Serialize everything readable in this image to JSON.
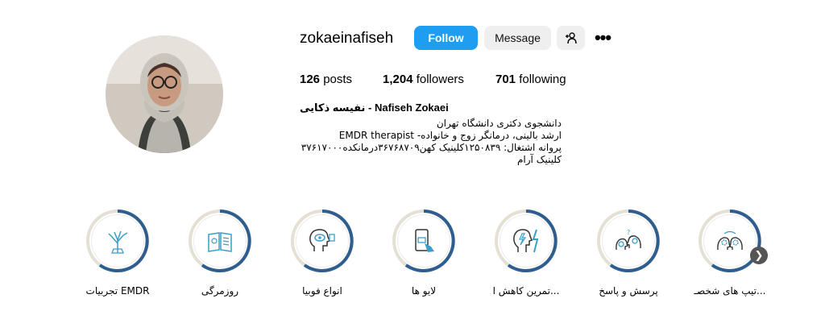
{
  "profile": {
    "username": "zokaeinafiseh",
    "follow_label": "Follow",
    "message_label": "Message",
    "add_user_icon": "add-user-icon",
    "more_icon": "more-options-icon",
    "more_glyph": "•••",
    "full_name": "نفیسه ذکایی - Nafiseh Zokaei",
    "bio_lines": [
      "دانشجوی دکتری دانشگاه تهران",
      "ارشد بالینی، درمانگر زوج و خانواده- EMDR therapist",
      "پروانه اشتغال: ۱۲۵۰۸۳۹کلینیک کهن۳۶۷۶۸۷۰۹درمانکده۳۷۶۱۷۰۰۰",
      "کلینیک آرام"
    ]
  },
  "stats": {
    "posts_count": "126",
    "posts_label": "posts",
    "followers_count": "1,204",
    "followers_label": "followers",
    "following_count": "701",
    "following_label": "following"
  },
  "highlights": [
    {
      "label": "تجربیات EMDR",
      "icon": "tree-icon"
    },
    {
      "label": "روزمرگی",
      "icon": "book-icon"
    },
    {
      "label": "انواع فوبیا",
      "icon": "head-eye-icon"
    },
    {
      "label": "لایو ها",
      "icon": "phone-tap-icon"
    },
    {
      "label": "تمرین کاهش ا...",
      "icon": "head-lightning-icon"
    },
    {
      "label": "پرسش و پاسخ",
      "icon": "heads-question-icon"
    },
    {
      "label": "تیپ های شخصـ...",
      "icon": "heads-gears-icon"
    }
  ],
  "next_arrow": "❯",
  "colors": {
    "accent": "#1e9df1",
    "ring_blue": "#2e5e8f",
    "ring_beige": "#e4e0d4",
    "icon_blue": "#3a9ec9"
  }
}
